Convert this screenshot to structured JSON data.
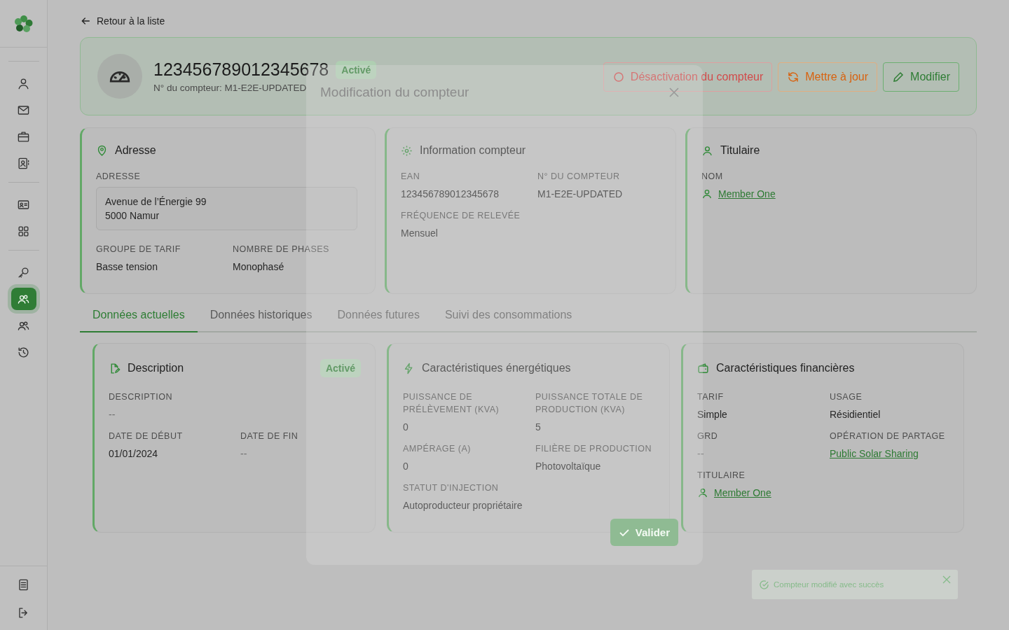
{
  "sidebar": {
    "groups": [
      {
        "items": [
          {
            "selected": false
          },
          {
            "selected": false
          },
          {
            "selected": false
          },
          {
            "selected": false
          }
        ]
      },
      {
        "items": [
          {
            "selected": false
          },
          {
            "selected": false
          }
        ]
      },
      {
        "items": [
          {
            "selected": false
          },
          {
            "selected": true
          },
          {
            "selected": false
          },
          {
            "selected": false
          }
        ]
      }
    ]
  },
  "back_link": "Retour à la liste",
  "meter": {
    "title": "123456789012345678",
    "status": "Activé",
    "subtitle": "N° du compteur: M1-E2E-UPDATED"
  },
  "actions": [
    {
      "kind": "danger",
      "label": "Désactivation du compteur"
    },
    {
      "kind": "warning",
      "label": "Mettre à jour"
    },
    {
      "kind": "primary",
      "label": "Modifier"
    }
  ],
  "address_card": {
    "title": "Adresse",
    "address_label": "ADRESSE",
    "address_lines": [
      "Avenue de l’Énergie 99",
      "5000 Namur"
    ],
    "fields": [
      {
        "label": "GROUPE DE TARIF",
        "value": "Basse tension",
        "kind": "text"
      },
      {
        "label": "NOMBRE DE PHASES",
        "value": "Monophasé",
        "kind": "text"
      }
    ]
  },
  "info_card": {
    "title": "Information compteur",
    "fields": [
      {
        "label": "EAN",
        "value": "123456789012345678",
        "kind": "text"
      },
      {
        "label": "N° DU COMPTEUR",
        "value": "M1-E2E-UPDATED",
        "kind": "text"
      },
      {
        "label": "FRÉQUENCE DE RELEVÉE",
        "value": "Mensuel",
        "kind": "text"
      }
    ]
  },
  "holder_card": {
    "title": "Titulaire",
    "fields": [
      {
        "label": "NOM",
        "value": "Member One",
        "kind": "person"
      }
    ]
  },
  "tabs": [
    {
      "label": "Données actuelles",
      "selected": true
    },
    {
      "label": "Données historiques",
      "selected": false
    },
    {
      "label": "Données futures",
      "selected": false
    },
    {
      "label": "Suivi des consommations",
      "selected": false
    }
  ],
  "description_card": {
    "title": "Description",
    "status": "Activé",
    "fields": [
      {
        "label": "DESCRIPTION",
        "value": "--",
        "kind": "muted"
      },
      {
        "label": "DATE DE DÉBUT",
        "value": "01/01/2024",
        "kind": "text"
      },
      {
        "label": "DATE DE FIN",
        "value": "--",
        "kind": "muted"
      }
    ]
  },
  "energy_card": {
    "title": "Caractéristiques énergétiques",
    "fields": [
      {
        "label": "PUISSANCE DE PRÉLÈVEMENT (KVA)",
        "value": "0",
        "kind": "text"
      },
      {
        "label": "PUISSANCE TOTALE DE PRODUCTION (KVA)",
        "value": "5",
        "kind": "text"
      },
      {
        "label": "AMPÉRAGE (A)",
        "value": "0",
        "kind": "text"
      },
      {
        "label": "FILIÈRE DE PRODUCTION",
        "value": "Photovoltaïque",
        "kind": "text"
      },
      {
        "label": "STATUT D'INJECTION",
        "value": "Autoproducteur propriétaire",
        "kind": "text"
      }
    ]
  },
  "finance_card": {
    "title": "Caractéristiques financières",
    "fields": [
      {
        "label": "TARIF",
        "value": "Simple",
        "kind": "text"
      },
      {
        "label": "USAGE",
        "value": "Résidientiel",
        "kind": "text"
      },
      {
        "label": "GRD",
        "value": "--",
        "kind": "muted"
      },
      {
        "label": "OPÉRATION DE PARTAGE",
        "value": "Public Solar Sharing",
        "kind": "link"
      },
      {
        "label": "TITULAIRE",
        "value": "Member One",
        "kind": "person"
      }
    ]
  },
  "modal": {
    "title": "Modification du compteur",
    "submit": "Valider"
  },
  "toast": {
    "message": "Compteur modifié avec succès"
  }
}
